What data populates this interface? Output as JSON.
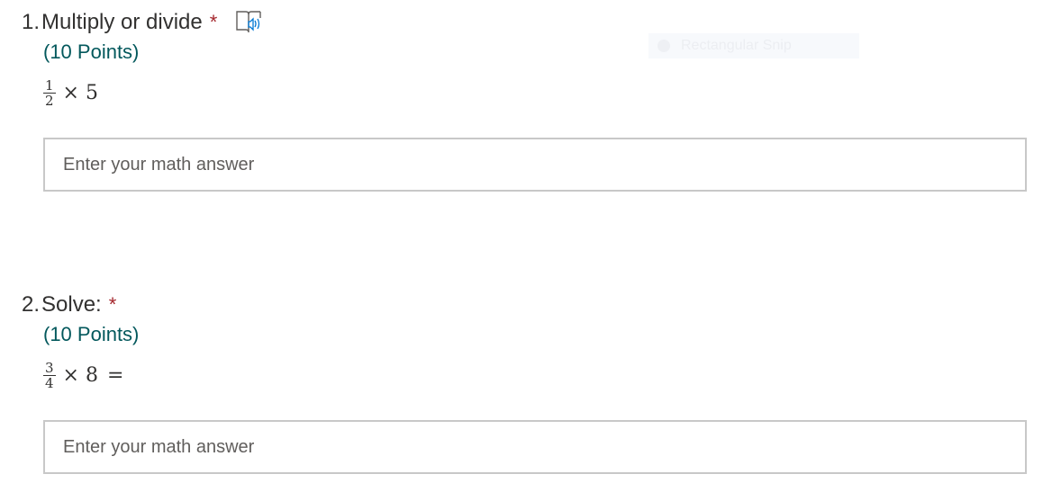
{
  "questions": [
    {
      "number": "1.",
      "title": "Multiply or divide",
      "required_mark": "*",
      "points": "(10 Points)",
      "expression": {
        "numerator": "1",
        "denominator": "2",
        "operator": "×",
        "operand": "5",
        "suffix": ""
      },
      "answer_placeholder": "Enter your math answer",
      "has_reader_icon": true
    },
    {
      "number": "2.",
      "title": "Solve:",
      "required_mark": "*",
      "points": "(10 Points)",
      "expression": {
        "numerator": "3",
        "denominator": "4",
        "operator": "×",
        "operand": "8",
        "suffix": "="
      },
      "answer_placeholder": "Enter your math answer",
      "has_reader_icon": false
    }
  ],
  "overlay": {
    "label": "Rectangular Snip"
  },
  "colors": {
    "required": "#a4262c",
    "points": "#03585c",
    "reader_icon": "#0078d4",
    "border": "#c8c8c8"
  },
  "icons": {
    "reader": "immersive-reader-icon"
  }
}
